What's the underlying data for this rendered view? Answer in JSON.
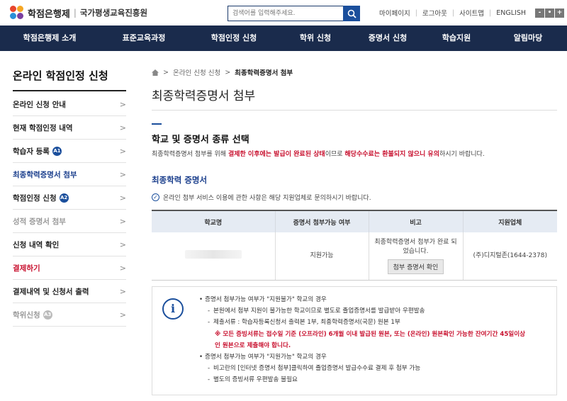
{
  "header": {
    "logo_text": "학점은행제",
    "logo_separator": "|",
    "org_name": "국가평생교육진흥원",
    "search_placeholder": "검색어를 입력해주세요.",
    "top_links": [
      "마이페이지",
      "로그아웃",
      "사이트맵",
      "ENGLISH"
    ],
    "zoom_buttons": [
      "-",
      "•",
      "+"
    ]
  },
  "gnb": [
    "학점은행제 소개",
    "표준교육과정",
    "학점인정 신청",
    "학위 신청",
    "증명서 신청",
    "학습지원",
    "알림마당"
  ],
  "sidebar": {
    "title": "온라인 학점인정 신청",
    "items": [
      {
        "label": "온라인 신청 안내",
        "badge": ""
      },
      {
        "label": "현재 학점인정 내역",
        "badge": ""
      },
      {
        "label": "학습자 등록",
        "badge": "A1"
      },
      {
        "label": "최종학력증명서 첨부",
        "badge": ""
      },
      {
        "label": "학점인정 신청",
        "badge": "A2"
      },
      {
        "label": "성적 증명서 첨부",
        "badge": ""
      },
      {
        "label": "신청 내역 확인",
        "badge": ""
      },
      {
        "label": "결제하기",
        "badge": ""
      },
      {
        "label": "결제내역 및 신청서 출력",
        "badge": ""
      },
      {
        "label": "학위신청",
        "badge": "A3"
      }
    ]
  },
  "breadcrumb": [
    "온라인 신청 신청",
    "최종학력증명서 첨부"
  ],
  "page_title": "최종학력증명서 첨부",
  "section": {
    "title": "학교 및 증명서 종류 선택",
    "desc_1": "최종학력증명서 첨부를 위해 ",
    "desc_red_1": "결제한 이후에는 발급이 완료된 상태",
    "desc_2": "이므로 ",
    "desc_red_2": "해당수수료는 환불되지 않으니 유의",
    "desc_3": "하시기 바랍니다."
  },
  "subsection": {
    "title": "최종학력 증명서",
    "notice": "온라인 첨부 서비스 이용에 관한 사항은 해당 지원업체로 문의하시기 바랍니다."
  },
  "table": {
    "headers": [
      "학교명",
      "증명서 첨부가능 여부",
      "비고",
      "지원업체"
    ],
    "row": {
      "availability": "지원가능",
      "remark_line1": "최종학력증명서 첨부가 완료 되",
      "remark_line2": "었습니다.",
      "button": "첨부 증명서 확인",
      "vendor": "(주)디지털존(1644-2378)"
    }
  },
  "info": {
    "icon": "i",
    "lines": [
      {
        "type": "b1",
        "text": "증명서 첨부가능 여부가 \"지원불가\" 학교의 경우"
      },
      {
        "type": "b2",
        "text": "본원에서 첨부 지원이 불가능한 학교이므로 별도로 졸업증명서를 발급받아 우편발송"
      },
      {
        "type": "b2",
        "text": "제출서류 : 학습자등록신청서 출력본 1부, 최종학력증명서(국문) 원본 1부"
      },
      {
        "type": "warn",
        "text": "※ 모든 증빙서류는 접수일 기준 (오프라인) 6개월 이내 발급된 원본, 또는 (온라인) 원본확인 가능한 잔여기간 45일이상"
      },
      {
        "type": "warn",
        "text": "인 원본으로 제출해야 합니다."
      },
      {
        "type": "b1",
        "text": "증명서 첨부가능 여부가 \"지원가능\" 학교의 경우"
      },
      {
        "type": "b2",
        "text": "비고란의 [인터넷 증명서 첨부]클릭하여 졸업증명서 발급수수료 결제 후 첨부 가능"
      },
      {
        "type": "b2",
        "text": "별도의 증빙서류 우편발송 불필요"
      }
    ]
  },
  "colors": {
    "navy": "#1a2b4c",
    "accent_blue": "#1b4f9c",
    "red": "#c8102e",
    "table_head": "#e5ebf3"
  }
}
